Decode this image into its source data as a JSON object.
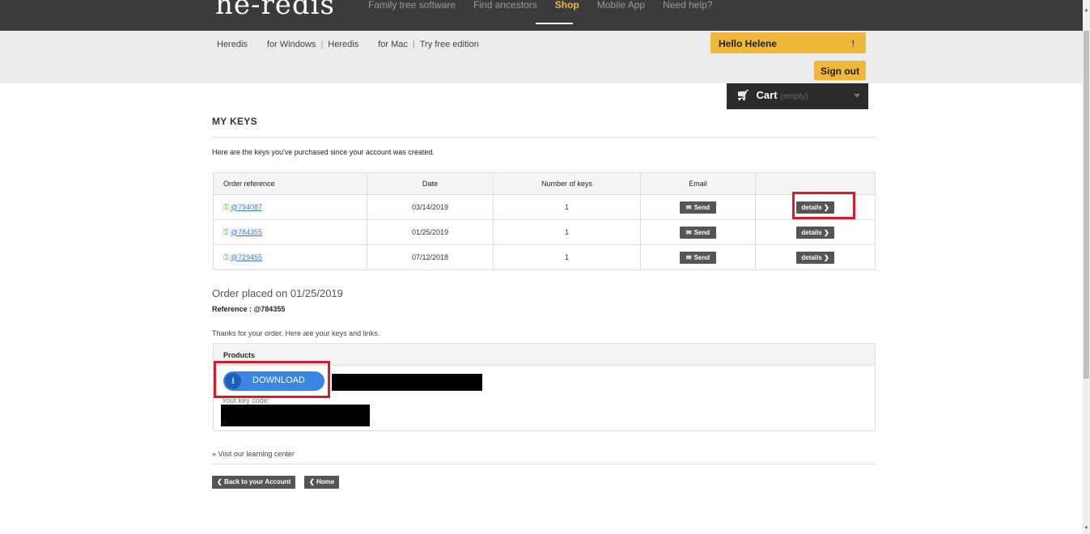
{
  "header": {
    "logo_text": "he-redis",
    "nav": [
      "Family tree software",
      "Find ancestors",
      "Shop",
      "Mobile App",
      "Need help?"
    ],
    "active_nav": "Shop",
    "accent_color": "#f0b83a"
  },
  "subbar": {
    "link1": "Heredis",
    "link2": "for Windows",
    "sep": "|",
    "link3": "Heredis",
    "link4": "for Mac",
    "link5": "Try free edition",
    "hello": "Hello Helene",
    "hello_suffix": "!",
    "signout": "Sign out"
  },
  "cart": {
    "icon": "cart-icon",
    "label": "Cart",
    "status": "(empty)"
  },
  "page": {
    "title": "MY KEYS",
    "intro": "Here are the keys you've purchased since your account was created."
  },
  "table": {
    "headers": [
      "Order reference",
      "Date",
      "Number of keys",
      "Email",
      ""
    ],
    "rows": [
      {
        "ref": "@794087",
        "date": "03/14/2019",
        "keys": "1",
        "send": "Send",
        "details": "details"
      },
      {
        "ref": "@784355",
        "date": "01/25/2019",
        "keys": "1",
        "send": "Send",
        "details": "details"
      },
      {
        "ref": "@729455",
        "date": "07/12/2018",
        "keys": "1",
        "send": "Send",
        "details": "details"
      }
    ]
  },
  "order": {
    "placed": "Order placed on 01/25/2019",
    "reference": "Reference : @784355",
    "thanks": "Thanks for your order. Here are your keys and links.",
    "products_header": "Products",
    "download_label": "DOWNLOAD",
    "key_code_label": "Your key code:"
  },
  "footer": {
    "visit": "» Visit our learning center",
    "back": "Back to your Account",
    "home": "Home"
  },
  "colors": {
    "highlight": "#d81b2b",
    "download": "#3a86e0"
  }
}
